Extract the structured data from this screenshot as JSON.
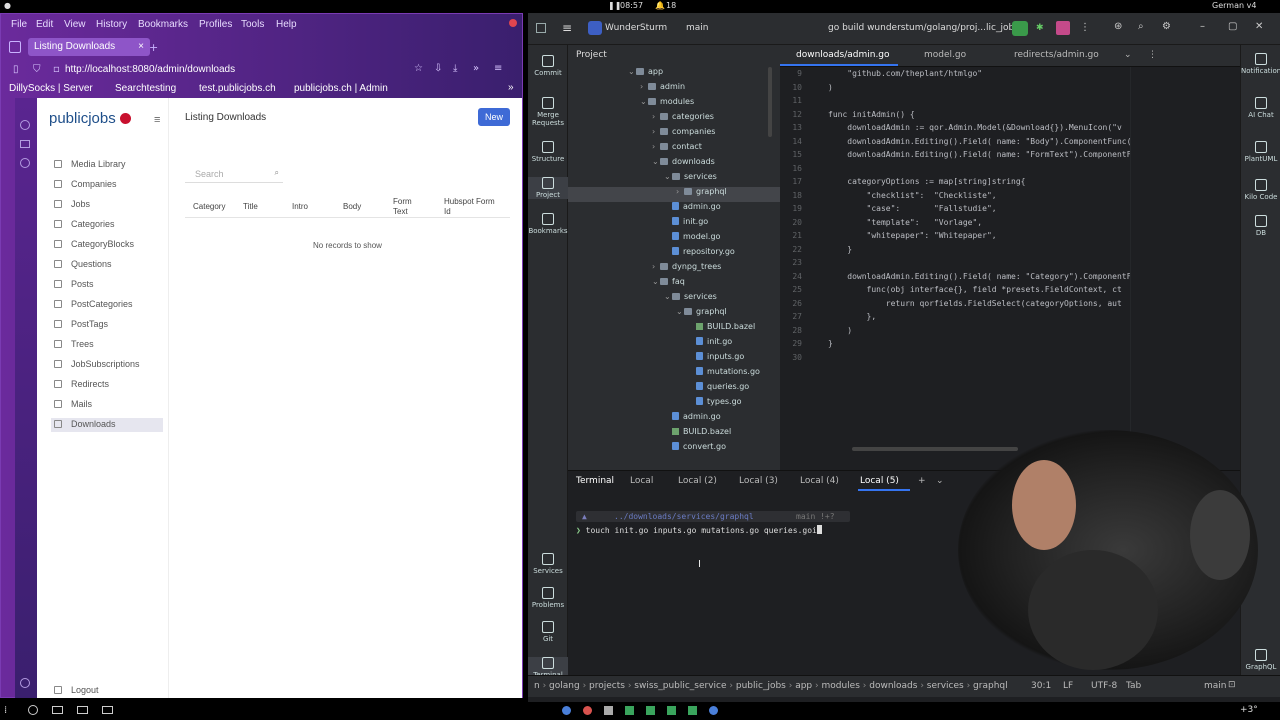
{
  "system": {
    "clock": "08:57",
    "notify_count": "18",
    "right_status": "German v4",
    "temp": "+3°"
  },
  "browser": {
    "menu": [
      "File",
      "Edit",
      "View",
      "History",
      "Bookmarks",
      "Profiles",
      "Tools",
      "Help"
    ],
    "tab_title": "Listing Downloads",
    "url": "http://localhost:8080/admin/downloads",
    "bookmarks": [
      "DillySocks | Server",
      "Searchtesting",
      "test.publicjobs.ch",
      "publicjobs.ch | Admin"
    ],
    "admin": {
      "logo": "publicjobs",
      "nav": [
        "Media Library",
        "Companies",
        "Jobs",
        "Categories",
        "CategoryBlocks",
        "Questions",
        "Posts",
        "PostCategories",
        "PostTags",
        "Trees",
        "JobSubscriptions",
        "Redirects",
        "Mails",
        "Downloads"
      ],
      "active_nav": "Downloads",
      "logout": "Logout",
      "page_title": "Listing Downloads",
      "new_button": "New",
      "search_placeholder": "Search",
      "columns": [
        "Category",
        "Title",
        "Intro",
        "Body",
        "Form Text",
        "Hubspot Form Id"
      ],
      "empty": "No records to show"
    }
  },
  "ide": {
    "project_name": "WunderSturm",
    "branch": "main",
    "run_config": "go build wunderstum/golang/proj...lic_jobs",
    "left_tools": [
      "Commit",
      "Merge Requests",
      "Structure",
      "Project",
      "Bookmarks",
      "Services",
      "Problems",
      "Git",
      "Terminal"
    ],
    "right_tools": [
      "Notifications",
      "AI Chat",
      "PlantUML",
      "Kilo Code",
      "DB",
      "GraphQL"
    ],
    "project_title": "Project",
    "tree": [
      {
        "label": "app",
        "depth": 0,
        "kind": "dir",
        "open": true
      },
      {
        "label": "admin",
        "depth": 1,
        "kind": "dir",
        "open": false
      },
      {
        "label": "modules",
        "depth": 1,
        "kind": "dir",
        "open": true
      },
      {
        "label": "categories",
        "depth": 2,
        "kind": "dir",
        "open": false
      },
      {
        "label": "companies",
        "depth": 2,
        "kind": "dir",
        "open": false
      },
      {
        "label": "contact",
        "depth": 2,
        "kind": "dir",
        "open": false
      },
      {
        "label": "downloads",
        "depth": 2,
        "kind": "dir",
        "open": true
      },
      {
        "label": "services",
        "depth": 3,
        "kind": "dir",
        "open": true
      },
      {
        "label": "graphql",
        "depth": 4,
        "kind": "dir",
        "open": false,
        "selected": true
      },
      {
        "label": "admin.go",
        "depth": 3,
        "kind": "go"
      },
      {
        "label": "init.go",
        "depth": 3,
        "kind": "go"
      },
      {
        "label": "model.go",
        "depth": 3,
        "kind": "go"
      },
      {
        "label": "repository.go",
        "depth": 3,
        "kind": "go"
      },
      {
        "label": "dynpg_trees",
        "depth": 2,
        "kind": "dir",
        "open": false
      },
      {
        "label": "faq",
        "depth": 2,
        "kind": "dir",
        "open": true
      },
      {
        "label": "services",
        "depth": 3,
        "kind": "dir",
        "open": true
      },
      {
        "label": "graphql",
        "depth": 4,
        "kind": "dir",
        "open": true
      },
      {
        "label": "BUILD.bazel",
        "depth": 5,
        "kind": "bazel"
      },
      {
        "label": "init.go",
        "depth": 5,
        "kind": "go"
      },
      {
        "label": "inputs.go",
        "depth": 5,
        "kind": "go"
      },
      {
        "label": "mutations.go",
        "depth": 5,
        "kind": "go"
      },
      {
        "label": "queries.go",
        "depth": 5,
        "kind": "go"
      },
      {
        "label": "types.go",
        "depth": 5,
        "kind": "go"
      },
      {
        "label": "admin.go",
        "depth": 3,
        "kind": "go"
      },
      {
        "label": "BUILD.bazel",
        "depth": 3,
        "kind": "bazel"
      },
      {
        "label": "convert.go",
        "depth": 3,
        "kind": "go"
      }
    ],
    "editor_tabs": [
      "downloads/admin.go",
      "model.go",
      "redirects/admin.go"
    ],
    "active_editor_tab": "downloads/admin.go",
    "code": [
      {
        "n": "9",
        "t": "    \"github.com/theplant/htmlgo\""
      },
      {
        "n": "10",
        "t": ")"
      },
      {
        "n": "11",
        "t": ""
      },
      {
        "n": "12",
        "t": "func initAdmin() {"
      },
      {
        "n": "13",
        "t": "    downloadAdmin := qor.Admin.Model(&Download{}).MenuIcon(\"v"
      },
      {
        "n": "14",
        "t": "    downloadAdmin.Editing().Field( name: \"Body\").ComponentFunc("
      },
      {
        "n": "15",
        "t": "    downloadAdmin.Editing().Field( name: \"FormText\").ComponentF"
      },
      {
        "n": "16",
        "t": ""
      },
      {
        "n": "17",
        "t": "    categoryOptions := map[string]string{"
      },
      {
        "n": "18",
        "t": "        \"checklist\":  \"Checkliste\","
      },
      {
        "n": "19",
        "t": "        \"case\":       \"Fallstudie\","
      },
      {
        "n": "20",
        "t": "        \"template\":   \"Vorlage\","
      },
      {
        "n": "21",
        "t": "        \"whitepaper\": \"Whitepaper\","
      },
      {
        "n": "22",
        "t": "    }"
      },
      {
        "n": "23",
        "t": ""
      },
      {
        "n": "24",
        "t": "    downloadAdmin.Editing().Field( name: \"Category\").ComponentF"
      },
      {
        "n": "25",
        "t": "        func(obj interface{}, field *presets.FieldContext, ct"
      },
      {
        "n": "26",
        "t": "            return qorfields.FieldSelect(categoryOptions, aut"
      },
      {
        "n": "27",
        "t": "        },"
      },
      {
        "n": "28",
        "t": "    )"
      },
      {
        "n": "29",
        "t": "}"
      },
      {
        "n": "30",
        "t": ""
      }
    ],
    "terminal_tabs": [
      "Terminal",
      "Local",
      "Local (2)",
      "Local (3)",
      "Local (4)",
      "Local (5)"
    ],
    "active_terminal_tab": "Local (5)",
    "prompt_path": "../downloads/services/graphql",
    "prompt_branch": "main !+?",
    "command": "touch init.go inputs.go mutations.go queries.goi",
    "breadcrumb": [
      "n",
      "golang",
      "projects",
      "swiss_public_service",
      "public_jobs",
      "app",
      "modules",
      "downloads",
      "services",
      "graphql"
    ],
    "status_right": [
      "30:1",
      "LF",
      "UTF-8",
      "Tab",
      "main"
    ]
  }
}
